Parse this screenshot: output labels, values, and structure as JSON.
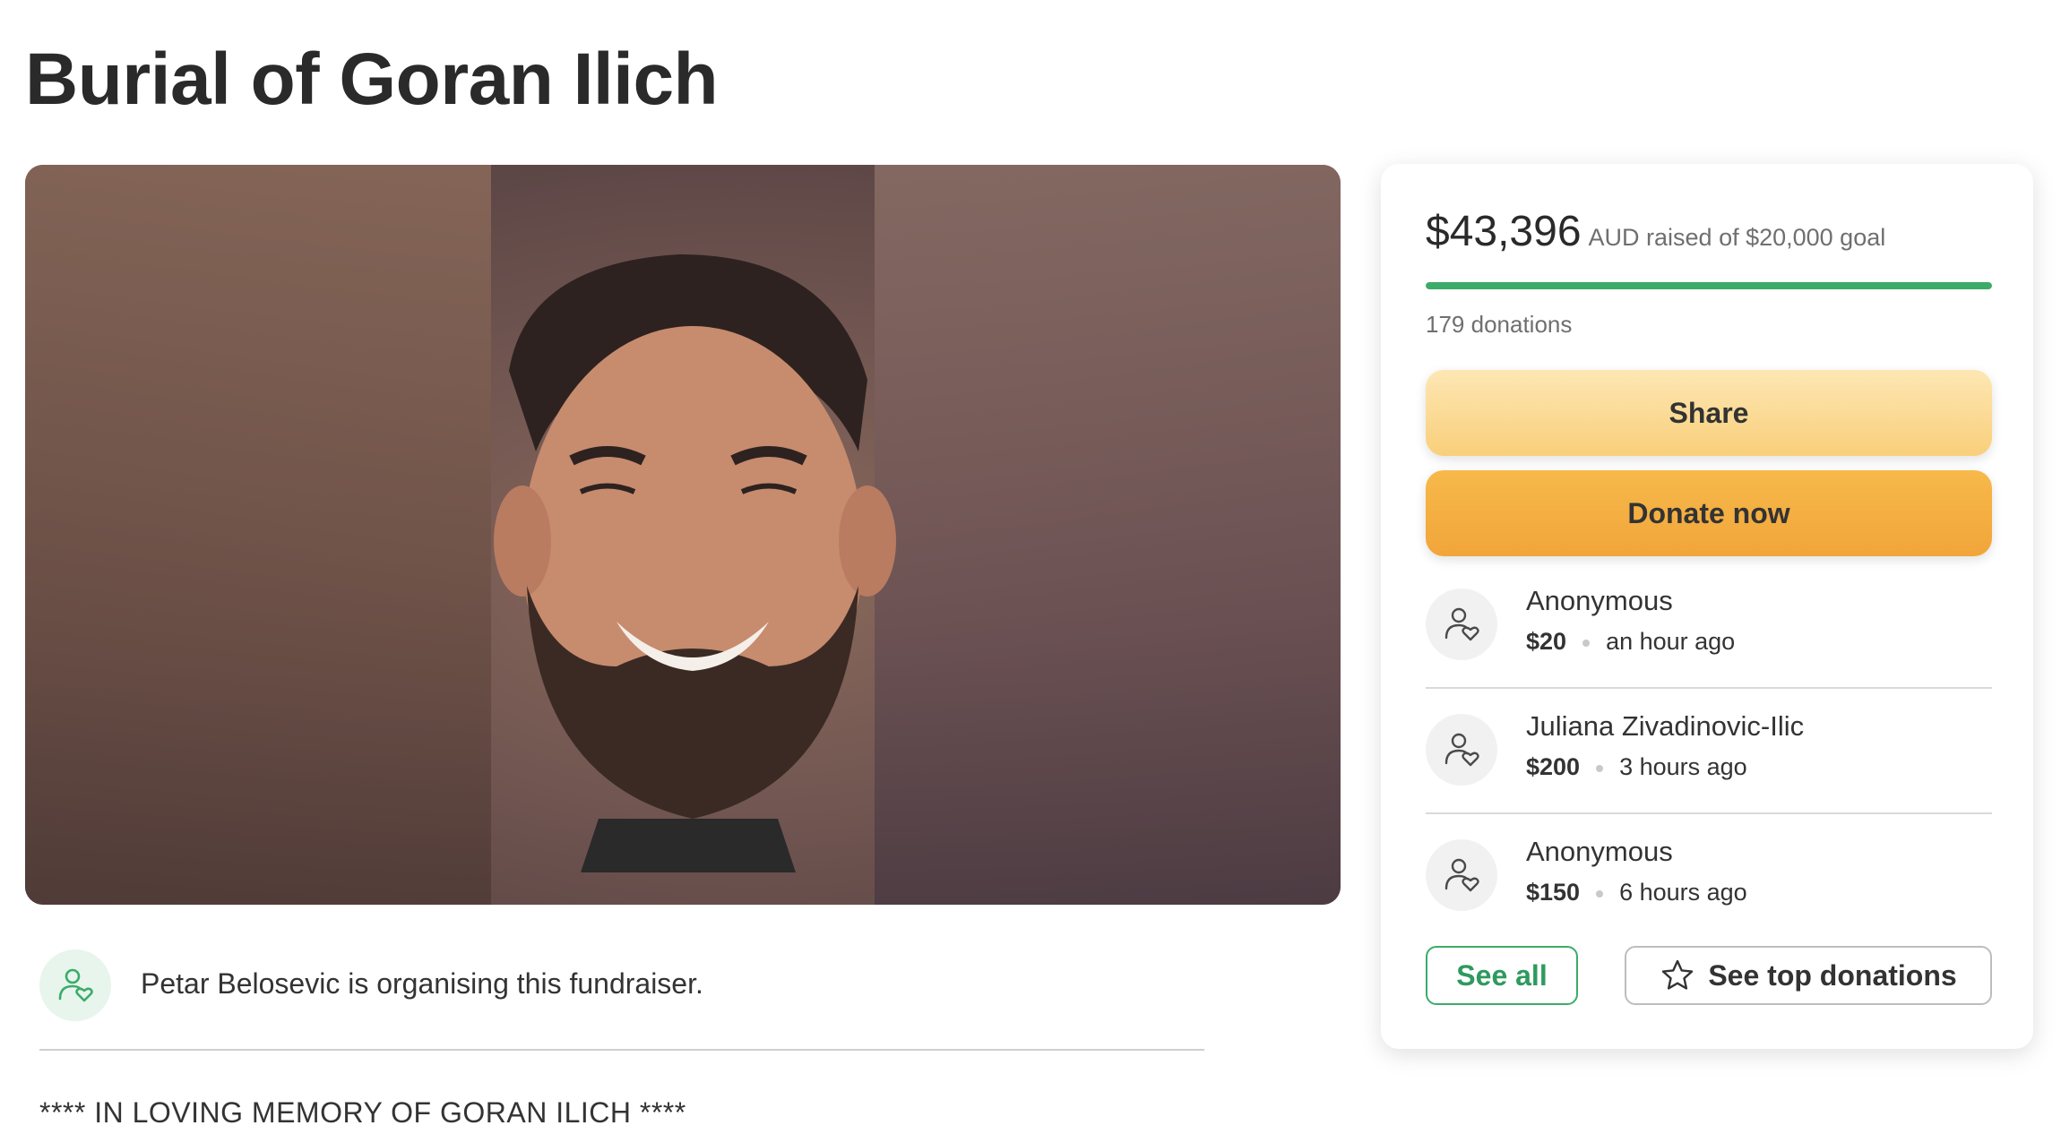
{
  "page": {
    "title": "Burial of Goran Ilich"
  },
  "organiser": {
    "text": "Petar Belosevic is organising this fundraiser."
  },
  "story": {
    "first_line": "**** IN LOVING MEMORY OF GORAN ILICH ****"
  },
  "donation_card": {
    "amount_raised": "$43,396",
    "goal_text": "AUD raised of $20,000 goal",
    "progress_fraction": 1.0,
    "donation_count": "179 donations",
    "share_label": "Share",
    "donate_label": "Donate now",
    "donations": [
      {
        "name": "Anonymous",
        "amount": "$20",
        "time": "an hour ago"
      },
      {
        "name": "Juliana Zivadinovic-Ilic",
        "amount": "$200",
        "time": "3 hours ago"
      },
      {
        "name": "Anonymous",
        "amount": "$150",
        "time": "6 hours ago"
      }
    ],
    "see_all_label": "See all",
    "see_top_label": "See top donations"
  },
  "colors": {
    "accent_green": "#3cab6a",
    "donate_orange": "#f1a53a",
    "share_yellow": "#f9cf7a"
  },
  "icons": {
    "donor_icon": "person-heart-icon",
    "star_icon": "star-icon"
  }
}
